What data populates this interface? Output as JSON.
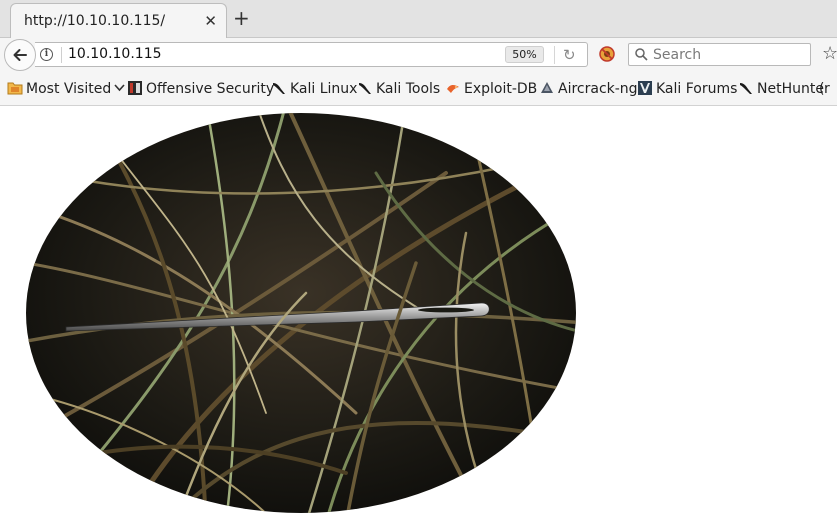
{
  "tab": {
    "title": "http://10.10.10.115/",
    "close_glyph": "✕"
  },
  "new_tab_glyph": "+",
  "urlbar": {
    "url": "10.10.10.115",
    "zoom": "50%"
  },
  "search": {
    "placeholder": "Search"
  },
  "bookmarks": [
    {
      "label": "Most Visited",
      "icon": "folder-icon",
      "dropdown": true
    },
    {
      "label": "Offensive Security",
      "icon": "offsec-icon"
    },
    {
      "label": "Kali Linux",
      "icon": "kali-dragon-icon"
    },
    {
      "label": "Kali Tools",
      "icon": "kali-dragon-icon"
    },
    {
      "label": "Exploit-DB",
      "icon": "exploitdb-icon"
    },
    {
      "label": "Aircrack-ng",
      "icon": "aircrack-icon"
    },
    {
      "label": "Kali Forums",
      "icon": "kali-forums-icon"
    },
    {
      "label": "NetHunter",
      "icon": "kali-dragon-icon"
    }
  ],
  "page": {
    "image": "needle-in-haystack-icon"
  },
  "colors": {
    "chrome_bg": "#f5f5f5",
    "tabstrip_bg": "#e3e3e3",
    "page_bg": "#ffffff"
  }
}
